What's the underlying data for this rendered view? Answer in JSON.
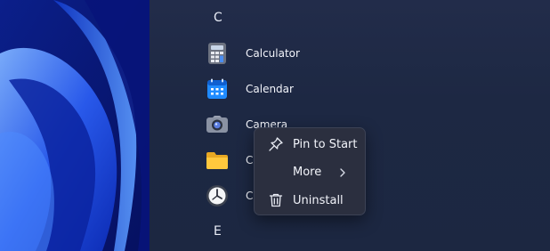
{
  "start_menu": {
    "sections": [
      {
        "letter": "C"
      },
      {
        "letter": "E"
      }
    ],
    "apps": [
      {
        "label": "Calculator",
        "icon": "calculator-icon"
      },
      {
        "label": "Calendar",
        "icon": "calendar-icon"
      },
      {
        "label": "Camera",
        "icon": "camera-icon"
      },
      {
        "label": "C",
        "icon": "folder-icon"
      },
      {
        "label": "C",
        "icon": "clock-icon"
      }
    ]
  },
  "context_menu": {
    "items": [
      {
        "label": "Pin to Start",
        "icon": "pin-icon"
      },
      {
        "label": "More",
        "icon": "",
        "submenu": true
      },
      {
        "label": "Uninstall",
        "icon": "trash-icon"
      }
    ]
  },
  "colors": {
    "wallpaper_base": "#0a1a6e",
    "wallpaper_highlight": "#3f7dff",
    "panel_background": "#1e2944",
    "menu_background": "#2b2f3f",
    "text": "#f2f4fa"
  }
}
